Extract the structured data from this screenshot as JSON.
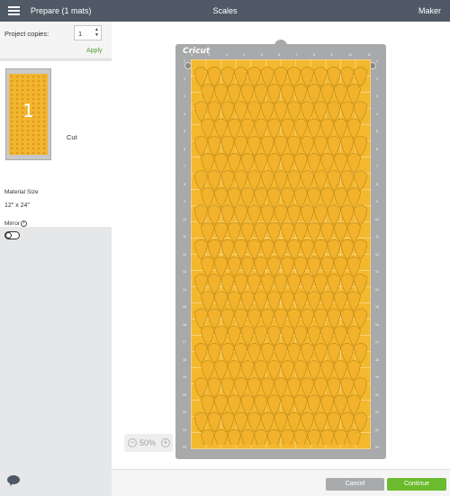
{
  "header": {
    "prepare_title": "Prepare (1 mats)",
    "center_title": "Scales",
    "maker_label": "Maker"
  },
  "sidebar": {
    "copies_label": "Project copies:",
    "copies_value": "1",
    "apply_label": "Apply",
    "mat": {
      "number": "1",
      "mode": "Cut",
      "material_size_label": "Material Size",
      "material_size_value": "12\" x 24\"",
      "mirror_label": "Mirror",
      "mirror_on": false
    }
  },
  "canvas": {
    "brand": "Cricut",
    "zoom": "50%",
    "ruler_top": [
      "1",
      "2",
      "3",
      "4",
      "5",
      "6",
      "7",
      "8",
      "9",
      "10",
      "11"
    ],
    "ruler_side": [
      "1",
      "2",
      "3",
      "4",
      "5",
      "6",
      "7",
      "8",
      "9",
      "10",
      "11",
      "12",
      "13",
      "14",
      "15",
      "16",
      "17",
      "18",
      "19",
      "20",
      "21",
      "22",
      "23"
    ],
    "colors": {
      "mat": "#f4b82f",
      "scale_fill": "#f2b22b",
      "scale_stroke": "#b88415"
    }
  },
  "footer": {
    "cancel_label": "Cancel",
    "continue_label": "Continue"
  },
  "colors": {
    "topbar": "#505a66",
    "accent_green": "#6abb2d",
    "apply_green": "#52a034"
  }
}
